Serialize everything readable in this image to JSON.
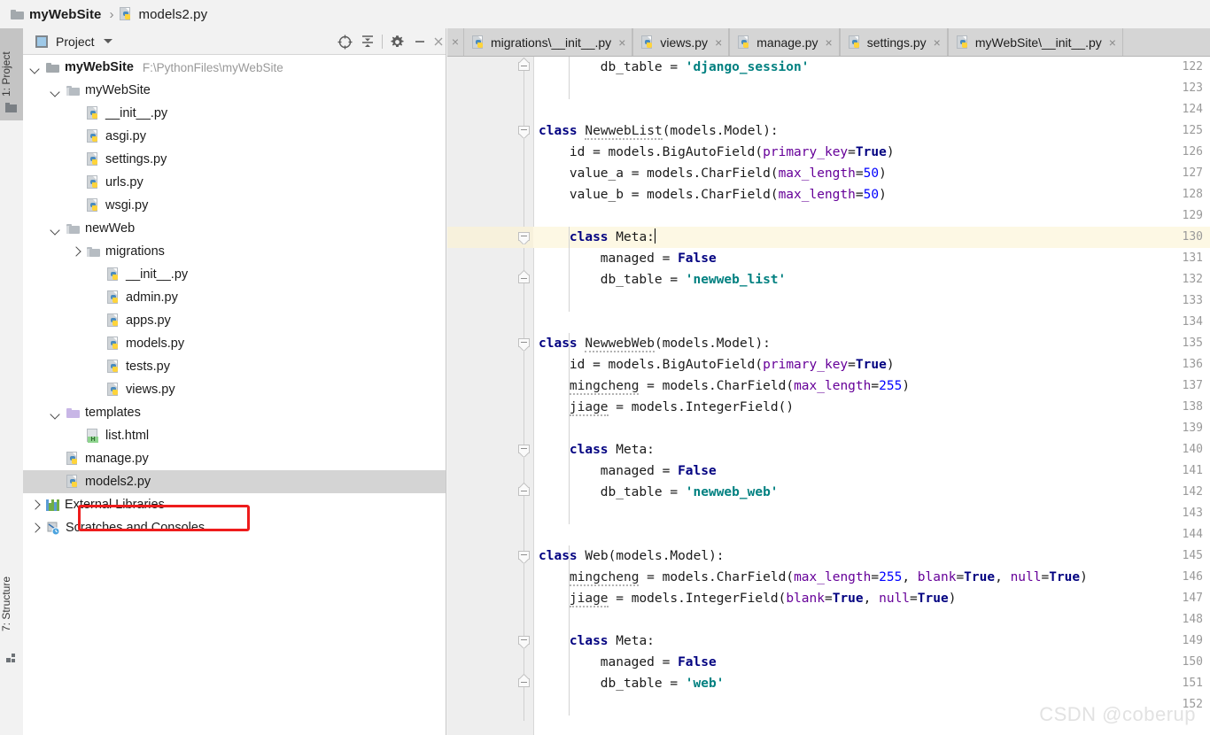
{
  "breadcrumb": {
    "project_name": "myWebSite",
    "separator": "›",
    "file_name": "models2.py"
  },
  "left_strip": {
    "project_tab": "1: Project",
    "structure_tab": "7: Structure"
  },
  "project_panel": {
    "title": "Project",
    "actions": [
      {
        "name": "locate-icon",
        "tooltip": "Select Opened File"
      },
      {
        "name": "collapse-all-icon",
        "tooltip": "Collapse All"
      },
      {
        "name": "gear-icon",
        "tooltip": "Settings"
      },
      {
        "name": "minimize-icon",
        "tooltip": "Hide"
      },
      {
        "name": "close-icon",
        "tooltip": "Close"
      }
    ],
    "tree": [
      {
        "label": "myWebSite",
        "path": "F:\\PythonFiles\\myWebSite",
        "icon": "folder",
        "indent": 0,
        "arrow": "down",
        "bold": true,
        "selected": false
      },
      {
        "label": "myWebSite",
        "path": "",
        "icon": "folder-module",
        "indent": 1,
        "arrow": "down",
        "bold": false,
        "selected": false
      },
      {
        "label": "__init__.py",
        "path": "",
        "icon": "python-file",
        "indent": 2,
        "arrow": "none",
        "bold": false,
        "selected": false
      },
      {
        "label": "asgi.py",
        "path": "",
        "icon": "python-file",
        "indent": 2,
        "arrow": "none",
        "bold": false,
        "selected": false
      },
      {
        "label": "settings.py",
        "path": "",
        "icon": "python-file",
        "indent": 2,
        "arrow": "none",
        "bold": false,
        "selected": false
      },
      {
        "label": "urls.py",
        "path": "",
        "icon": "python-file",
        "indent": 2,
        "arrow": "none",
        "bold": false,
        "selected": false
      },
      {
        "label": "wsgi.py",
        "path": "",
        "icon": "python-file",
        "indent": 2,
        "arrow": "none",
        "bold": false,
        "selected": false
      },
      {
        "label": "newWeb",
        "path": "",
        "icon": "folder-module",
        "indent": 1,
        "arrow": "down",
        "bold": false,
        "selected": false
      },
      {
        "label": "migrations",
        "path": "",
        "icon": "folder-module",
        "indent": 2,
        "arrow": "right",
        "bold": false,
        "selected": false
      },
      {
        "label": "__init__.py",
        "path": "",
        "icon": "python-file",
        "indent": 3,
        "arrow": "none",
        "bold": false,
        "selected": false
      },
      {
        "label": "admin.py",
        "path": "",
        "icon": "python-file",
        "indent": 3,
        "arrow": "none",
        "bold": false,
        "selected": false
      },
      {
        "label": "apps.py",
        "path": "",
        "icon": "python-file",
        "indent": 3,
        "arrow": "none",
        "bold": false,
        "selected": false
      },
      {
        "label": "models.py",
        "path": "",
        "icon": "python-file",
        "indent": 3,
        "arrow": "none",
        "bold": false,
        "selected": false
      },
      {
        "label": "tests.py",
        "path": "",
        "icon": "python-file",
        "indent": 3,
        "arrow": "none",
        "bold": false,
        "selected": false
      },
      {
        "label": "views.py",
        "path": "",
        "icon": "python-file",
        "indent": 3,
        "arrow": "none",
        "bold": false,
        "selected": false
      },
      {
        "label": "templates",
        "path": "",
        "icon": "folder-templates",
        "indent": 1,
        "arrow": "down",
        "bold": false,
        "selected": false
      },
      {
        "label": "list.html",
        "path": "",
        "icon": "html-file",
        "indent": 2,
        "arrow": "none",
        "bold": false,
        "selected": false
      },
      {
        "label": "manage.py",
        "path": "",
        "icon": "python-file",
        "indent": 1,
        "arrow": "none",
        "bold": false,
        "selected": false
      },
      {
        "label": "models2.py",
        "path": "",
        "icon": "python-file",
        "indent": 1,
        "arrow": "none",
        "bold": false,
        "selected": true
      },
      {
        "label": "External Libraries",
        "path": "",
        "icon": "library",
        "indent": 0,
        "arrow": "right",
        "bold": false,
        "selected": false
      },
      {
        "label": "Scratches and Consoles",
        "path": "",
        "icon": "scratch",
        "indent": 0,
        "arrow": "right",
        "bold": false,
        "selected": false
      }
    ],
    "annotation": {
      "color": "#ee1c1c",
      "targets": "models2.py"
    }
  },
  "editor": {
    "tabs": [
      {
        "label": "migrations\\__init__.py",
        "icon": "python-file",
        "active": false
      },
      {
        "label": "views.py",
        "icon": "python-file",
        "active": false
      },
      {
        "label": "manage.py",
        "icon": "python-file",
        "active": false
      },
      {
        "label": "settings.py",
        "icon": "python-file",
        "active": false
      },
      {
        "label": "myWebSite\\__init__.py",
        "icon": "python-file",
        "active": false
      }
    ],
    "close_label": "×",
    "first_line_number": 122,
    "current_line": 130,
    "lines": [
      {
        "n": 122,
        "indent": 8,
        "tokens": [
          {
            "t": "db_table ",
            "c": "pln"
          },
          {
            "t": "= ",
            "c": "pln"
          },
          {
            "t": "'django_session'",
            "c": "str"
          }
        ]
      },
      {
        "n": 123,
        "indent": 0,
        "tokens": []
      },
      {
        "n": 124,
        "indent": 0,
        "tokens": []
      },
      {
        "n": 125,
        "indent": 0,
        "tokens": [
          {
            "t": "class ",
            "c": "kw"
          },
          {
            "t": "NewwebList",
            "c": "wav"
          },
          {
            "t": "(models.Model):",
            "c": "pln"
          }
        ]
      },
      {
        "n": 126,
        "indent": 4,
        "tokens": [
          {
            "t": "id = models.BigAutoField(",
            "c": "pln"
          },
          {
            "t": "primary_key",
            "c": "par"
          },
          {
            "t": "=",
            "c": "pln"
          },
          {
            "t": "True",
            "c": "kw"
          },
          {
            "t": ")",
            "c": "pln"
          }
        ]
      },
      {
        "n": 127,
        "indent": 4,
        "tokens": [
          {
            "t": "value_a = models.CharField(",
            "c": "pln"
          },
          {
            "t": "max_length",
            "c": "par"
          },
          {
            "t": "=",
            "c": "pln"
          },
          {
            "t": "50",
            "c": "num"
          },
          {
            "t": ")",
            "c": "pln"
          }
        ]
      },
      {
        "n": 128,
        "indent": 4,
        "tokens": [
          {
            "t": "value_b = models.CharField(",
            "c": "pln"
          },
          {
            "t": "max_length",
            "c": "par"
          },
          {
            "t": "=",
            "c": "pln"
          },
          {
            "t": "50",
            "c": "num"
          },
          {
            "t": ")",
            "c": "pln"
          }
        ]
      },
      {
        "n": 129,
        "indent": 0,
        "tokens": []
      },
      {
        "n": 130,
        "indent": 4,
        "tokens": [
          {
            "t": "class ",
            "c": "kw"
          },
          {
            "t": "Meta:",
            "c": "pln"
          }
        ],
        "caret": true
      },
      {
        "n": 131,
        "indent": 8,
        "tokens": [
          {
            "t": "managed = ",
            "c": "pln"
          },
          {
            "t": "False",
            "c": "kw"
          }
        ]
      },
      {
        "n": 132,
        "indent": 8,
        "tokens": [
          {
            "t": "db_table = ",
            "c": "pln"
          },
          {
            "t": "'newweb_list'",
            "c": "str"
          }
        ]
      },
      {
        "n": 133,
        "indent": 0,
        "tokens": []
      },
      {
        "n": 134,
        "indent": 0,
        "tokens": []
      },
      {
        "n": 135,
        "indent": 0,
        "tokens": [
          {
            "t": "class ",
            "c": "kw"
          },
          {
            "t": "NewwebWeb",
            "c": "wav"
          },
          {
            "t": "(models.Model):",
            "c": "pln"
          }
        ]
      },
      {
        "n": 136,
        "indent": 4,
        "tokens": [
          {
            "t": "id = models.BigAutoField(",
            "c": "pln"
          },
          {
            "t": "primary_key",
            "c": "par"
          },
          {
            "t": "=",
            "c": "pln"
          },
          {
            "t": "True",
            "c": "kw"
          },
          {
            "t": ")",
            "c": "pln"
          }
        ]
      },
      {
        "n": 137,
        "indent": 4,
        "tokens": [
          {
            "t": "mingcheng",
            "c": "wav"
          },
          {
            "t": " = models.CharField(",
            "c": "pln"
          },
          {
            "t": "max_length",
            "c": "par"
          },
          {
            "t": "=",
            "c": "pln"
          },
          {
            "t": "255",
            "c": "num"
          },
          {
            "t": ")",
            "c": "pln"
          }
        ]
      },
      {
        "n": 138,
        "indent": 4,
        "tokens": [
          {
            "t": "jiage",
            "c": "wav"
          },
          {
            "t": " = models.IntegerField()",
            "c": "pln"
          }
        ]
      },
      {
        "n": 139,
        "indent": 0,
        "tokens": []
      },
      {
        "n": 140,
        "indent": 4,
        "tokens": [
          {
            "t": "class ",
            "c": "kw"
          },
          {
            "t": "Meta:",
            "c": "pln"
          }
        ]
      },
      {
        "n": 141,
        "indent": 8,
        "tokens": [
          {
            "t": "managed = ",
            "c": "pln"
          },
          {
            "t": "False",
            "c": "kw"
          }
        ]
      },
      {
        "n": 142,
        "indent": 8,
        "tokens": [
          {
            "t": "db_table = ",
            "c": "pln"
          },
          {
            "t": "'newweb_web'",
            "c": "str"
          }
        ]
      },
      {
        "n": 143,
        "indent": 0,
        "tokens": []
      },
      {
        "n": 144,
        "indent": 0,
        "tokens": []
      },
      {
        "n": 145,
        "indent": 0,
        "tokens": [
          {
            "t": "class ",
            "c": "kw"
          },
          {
            "t": "Web",
            "c": "pln"
          },
          {
            "t": "(models.Model):",
            "c": "pln"
          }
        ]
      },
      {
        "n": 146,
        "indent": 4,
        "tokens": [
          {
            "t": "mingcheng",
            "c": "wav"
          },
          {
            "t": " = models.CharField(",
            "c": "pln"
          },
          {
            "t": "max_length",
            "c": "par"
          },
          {
            "t": "=",
            "c": "pln"
          },
          {
            "t": "255",
            "c": "num"
          },
          {
            "t": ", ",
            "c": "pln"
          },
          {
            "t": "blank",
            "c": "par"
          },
          {
            "t": "=",
            "c": "pln"
          },
          {
            "t": "True",
            "c": "kw"
          },
          {
            "t": ", ",
            "c": "pln"
          },
          {
            "t": "null",
            "c": "par"
          },
          {
            "t": "=",
            "c": "pln"
          },
          {
            "t": "True",
            "c": "kw"
          },
          {
            "t": ")",
            "c": "pln"
          }
        ]
      },
      {
        "n": 147,
        "indent": 4,
        "tokens": [
          {
            "t": "jiage",
            "c": "wav"
          },
          {
            "t": " = models.IntegerField(",
            "c": "pln"
          },
          {
            "t": "blank",
            "c": "par"
          },
          {
            "t": "=",
            "c": "pln"
          },
          {
            "t": "True",
            "c": "kw"
          },
          {
            "t": ", ",
            "c": "pln"
          },
          {
            "t": "null",
            "c": "par"
          },
          {
            "t": "=",
            "c": "pln"
          },
          {
            "t": "True",
            "c": "kw"
          },
          {
            "t": ")",
            "c": "pln"
          }
        ]
      },
      {
        "n": 148,
        "indent": 0,
        "tokens": []
      },
      {
        "n": 149,
        "indent": 4,
        "tokens": [
          {
            "t": "class ",
            "c": "kw"
          },
          {
            "t": "Meta:",
            "c": "pln"
          }
        ]
      },
      {
        "n": 150,
        "indent": 8,
        "tokens": [
          {
            "t": "managed = ",
            "c": "pln"
          },
          {
            "t": "False",
            "c": "kw"
          }
        ]
      },
      {
        "n": 151,
        "indent": 8,
        "tokens": [
          {
            "t": "db_table = ",
            "c": "pln"
          },
          {
            "t": "'web'",
            "c": "str"
          }
        ]
      },
      {
        "n": 152,
        "indent": 0,
        "tokens": []
      }
    ],
    "fold_markers": [
      {
        "line": 122,
        "type": "bot"
      },
      {
        "line": 125,
        "type": "top"
      },
      {
        "line": 130,
        "type": "top"
      },
      {
        "line": 132,
        "type": "bot"
      },
      {
        "line": 135,
        "type": "top"
      },
      {
        "line": 140,
        "type": "top"
      },
      {
        "line": 142,
        "type": "bot"
      },
      {
        "line": 145,
        "type": "top"
      },
      {
        "line": 149,
        "type": "top"
      },
      {
        "line": 151,
        "type": "bot"
      }
    ]
  },
  "watermark": "CSDN @coberup",
  "colors": {
    "keyword": "#000080",
    "string": "#008080",
    "param": "#660099",
    "number": "#0000ff",
    "current_line": "#fdf8e4",
    "annotation": "#ee1c1c",
    "selection": "#d4d4d4"
  }
}
